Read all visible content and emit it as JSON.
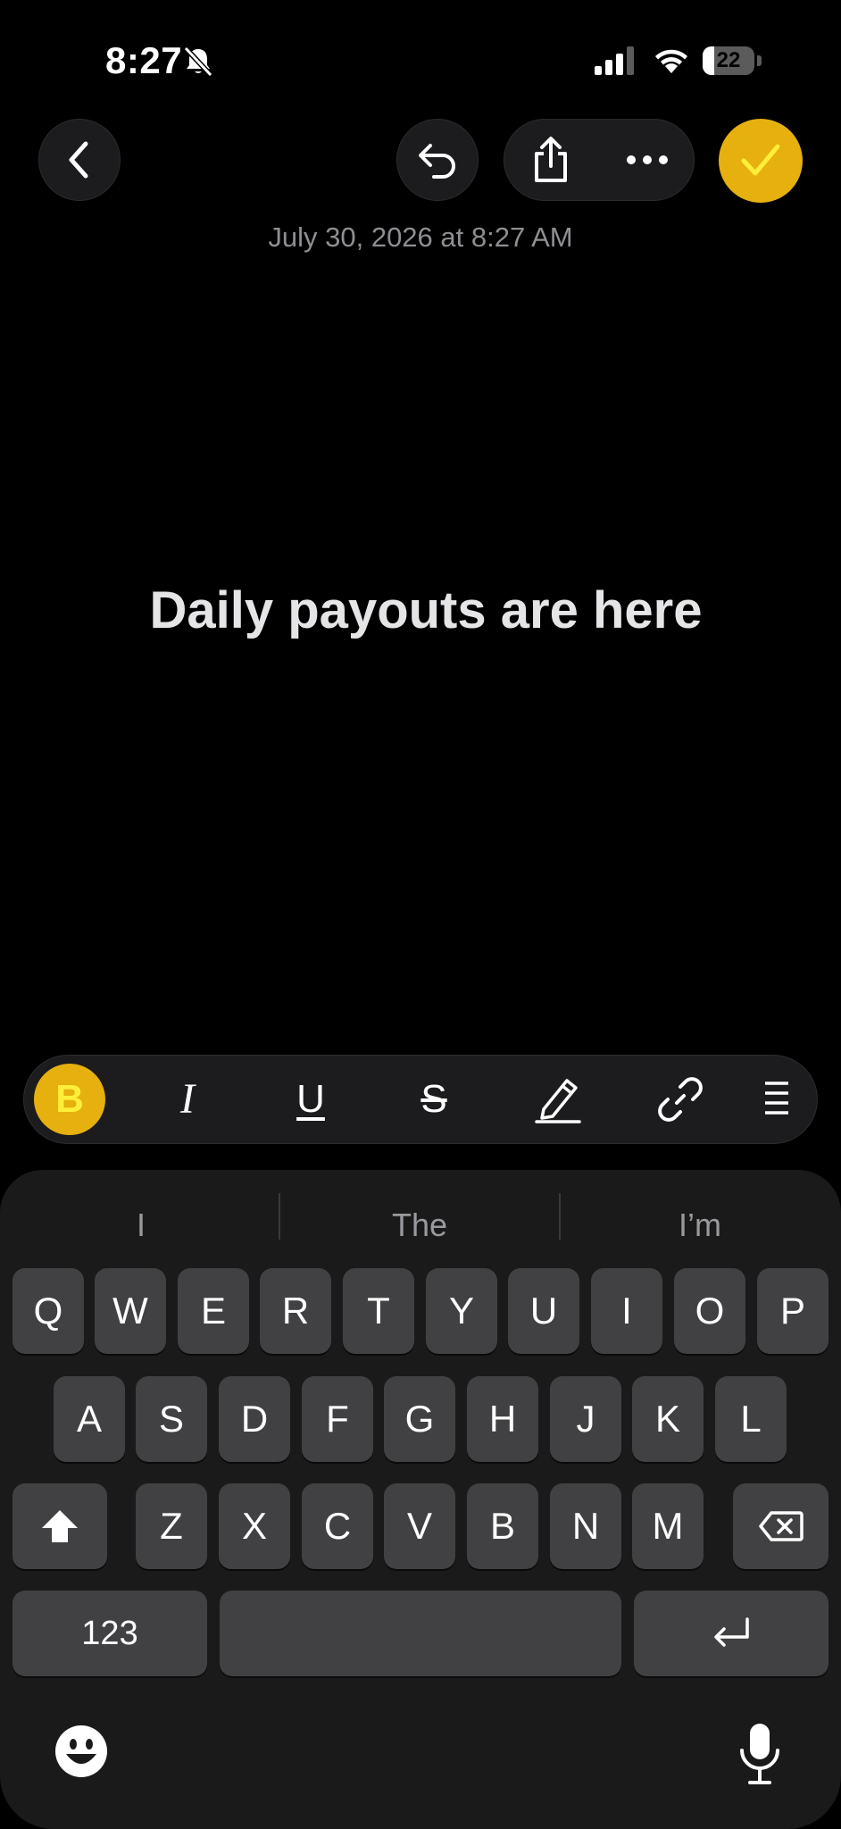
{
  "status_bar": {
    "time": "8:27",
    "battery_level": "22",
    "icons": [
      "bell-slash-icon",
      "cellular-signal-icon",
      "wifi-icon",
      "battery-icon"
    ]
  },
  "toolbar": {
    "back": "chevron-left-icon",
    "undo": "undo-icon",
    "share": "share-icon",
    "more": "ellipsis-icon",
    "done": "checkmark-icon",
    "accent": "#E6B00F"
  },
  "note": {
    "date": "July 30, 2026 at 8:27 AM",
    "title": "Daily payouts are here"
  },
  "format_bar": {
    "bold": "B",
    "italic": "I",
    "underline": "U",
    "strike": "S",
    "icons": [
      "highlighter-icon",
      "link-icon",
      "list-icon"
    ]
  },
  "keyboard": {
    "suggestions": [
      "I",
      "The",
      "I’m"
    ],
    "row1": [
      "Q",
      "W",
      "E",
      "R",
      "T",
      "Y",
      "U",
      "I",
      "O",
      "P"
    ],
    "row2": [
      "A",
      "S",
      "D",
      "F",
      "G",
      "H",
      "J",
      "K",
      "L"
    ],
    "row3": [
      "Z",
      "X",
      "C",
      "V",
      "B",
      "N",
      "M"
    ],
    "numbers_label": "123",
    "icons": [
      "shift-icon",
      "delete-icon",
      "return-icon",
      "emoji-icon",
      "microphone-icon"
    ]
  }
}
